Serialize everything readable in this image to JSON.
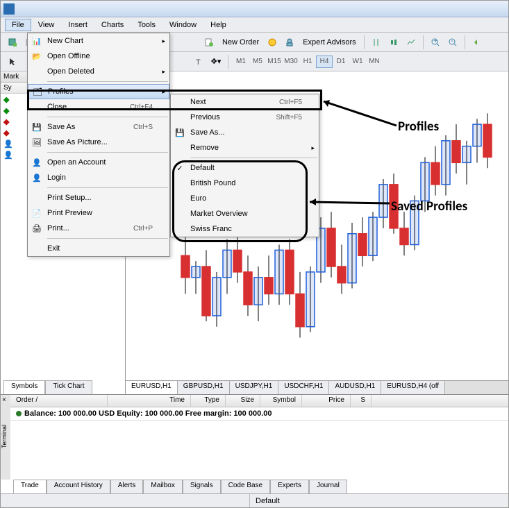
{
  "menubar": [
    "File",
    "View",
    "Insert",
    "Charts",
    "Tools",
    "Window",
    "Help"
  ],
  "toolbar2": {
    "newOrder": "New Order",
    "expertAdvisors": "Expert Advisors"
  },
  "timeframes": [
    "M1",
    "M5",
    "M15",
    "M30",
    "H1",
    "H4",
    "D1",
    "W1",
    "MN"
  ],
  "activeTimeframe": "H4",
  "marketWatch": {
    "title": "Mark",
    "cols": [
      "Sy"
    ]
  },
  "fileMenu": {
    "newChart": "New Chart",
    "openOffline": "Open Offline",
    "openDeleted": "Open Deleted",
    "profiles": "Profiles",
    "close": "Close",
    "closeShort": "Ctrl+F4",
    "saveAs": "Save As",
    "saveAsShort": "Ctrl+S",
    "savePic": "Save As Picture...",
    "openAcc": "Open an Account",
    "login": "Login",
    "printSetup": "Print Setup...",
    "printPreview": "Print Preview",
    "print": "Print...",
    "printShort": "Ctrl+P",
    "exit": "Exit"
  },
  "profilesMenu": {
    "next": "Next",
    "nextShort": "Ctrl+F5",
    "previous": "Previous",
    "prevShort": "Shift+F5",
    "saveAs": "Save As...",
    "remove": "Remove",
    "saved": [
      "Default",
      "British Pound",
      "Euro",
      "Market Overview",
      "Swiss Franc"
    ]
  },
  "chartTabs": [
    "EURUSD,H1",
    "GBPUSD,H1",
    "USDJPY,H1",
    "USDCHF,H1",
    "AUDUSD,H1",
    "EURUSD,H4 (off"
  ],
  "leftTabs": [
    "Symbols",
    "Tick Chart"
  ],
  "terminal": {
    "side": "Terminal",
    "headers": [
      "Order",
      "Time",
      "Type",
      "Size",
      "Symbol",
      "Price",
      "S"
    ],
    "balance": "Balance: 100 000.00 USD  Equity: 100 000.00  Free margin: 100 000.00",
    "tabs": [
      "Trade",
      "Account History",
      "Alerts",
      "Mailbox",
      "Signals",
      "Code Base",
      "Experts",
      "Journal"
    ]
  },
  "status": {
    "default": "Default"
  },
  "annotations": {
    "profiles": "Profiles",
    "saved": "Saved Profiles"
  },
  "chart_data": {
    "type": "candlestick",
    "note": "Candlestick OHLC estimated from pixels, range approx 1.300-1.320",
    "candles": [
      {
        "o": 1.3075,
        "h": 1.3095,
        "l": 1.304,
        "c": 1.3055,
        "dir": "down"
      },
      {
        "o": 1.3055,
        "h": 1.307,
        "l": 1.304,
        "c": 1.3065,
        "dir": "up"
      },
      {
        "o": 1.3065,
        "h": 1.308,
        "l": 1.3015,
        "c": 1.302,
        "dir": "down"
      },
      {
        "o": 1.302,
        "h": 1.306,
        "l": 1.301,
        "c": 1.3055,
        "dir": "up"
      },
      {
        "o": 1.3055,
        "h": 1.309,
        "l": 1.304,
        "c": 1.308,
        "dir": "up"
      },
      {
        "o": 1.308,
        "h": 1.31,
        "l": 1.305,
        "c": 1.306,
        "dir": "down"
      },
      {
        "o": 1.306,
        "h": 1.3075,
        "l": 1.302,
        "c": 1.303,
        "dir": "down"
      },
      {
        "o": 1.303,
        "h": 1.3065,
        "l": 1.3015,
        "c": 1.3055,
        "dir": "up"
      },
      {
        "o": 1.3055,
        "h": 1.3075,
        "l": 1.303,
        "c": 1.304,
        "dir": "down"
      },
      {
        "o": 1.304,
        "h": 1.3085,
        "l": 1.303,
        "c": 1.308,
        "dir": "up"
      },
      {
        "o": 1.308,
        "h": 1.309,
        "l": 1.303,
        "c": 1.304,
        "dir": "down"
      },
      {
        "o": 1.304,
        "h": 1.306,
        "l": 1.3,
        "c": 1.301,
        "dir": "down"
      },
      {
        "o": 1.301,
        "h": 1.3065,
        "l": 1.3005,
        "c": 1.306,
        "dir": "up"
      },
      {
        "o": 1.306,
        "h": 1.311,
        "l": 1.305,
        "c": 1.31,
        "dir": "up"
      },
      {
        "o": 1.31,
        "h": 1.3115,
        "l": 1.3055,
        "c": 1.3065,
        "dir": "down"
      },
      {
        "o": 1.3065,
        "h": 1.3085,
        "l": 1.304,
        "c": 1.305,
        "dir": "down"
      },
      {
        "o": 1.305,
        "h": 1.3105,
        "l": 1.3045,
        "c": 1.3095,
        "dir": "up"
      },
      {
        "o": 1.3095,
        "h": 1.311,
        "l": 1.3065,
        "c": 1.3075,
        "dir": "down"
      },
      {
        "o": 1.3075,
        "h": 1.3115,
        "l": 1.307,
        "c": 1.311,
        "dir": "up"
      },
      {
        "o": 1.311,
        "h": 1.3145,
        "l": 1.31,
        "c": 1.314,
        "dir": "up"
      },
      {
        "o": 1.314,
        "h": 1.315,
        "l": 1.3095,
        "c": 1.31,
        "dir": "down"
      },
      {
        "o": 1.31,
        "h": 1.3115,
        "l": 1.3075,
        "c": 1.3085,
        "dir": "down"
      },
      {
        "o": 1.3085,
        "h": 1.313,
        "l": 1.308,
        "c": 1.3125,
        "dir": "up"
      },
      {
        "o": 1.3125,
        "h": 1.3165,
        "l": 1.3115,
        "c": 1.316,
        "dir": "up"
      },
      {
        "o": 1.316,
        "h": 1.3175,
        "l": 1.313,
        "c": 1.314,
        "dir": "down"
      },
      {
        "o": 1.314,
        "h": 1.3185,
        "l": 1.313,
        "c": 1.318,
        "dir": "up"
      },
      {
        "o": 1.318,
        "h": 1.3195,
        "l": 1.315,
        "c": 1.316,
        "dir": "down"
      },
      {
        "o": 1.316,
        "h": 1.318,
        "l": 1.314,
        "c": 1.3175,
        "dir": "up"
      },
      {
        "o": 1.3175,
        "h": 1.32,
        "l": 1.316,
        "c": 1.3195,
        "dir": "up"
      },
      {
        "o": 1.3195,
        "h": 1.3205,
        "l": 1.3155,
        "c": 1.3165,
        "dir": "down"
      }
    ]
  }
}
